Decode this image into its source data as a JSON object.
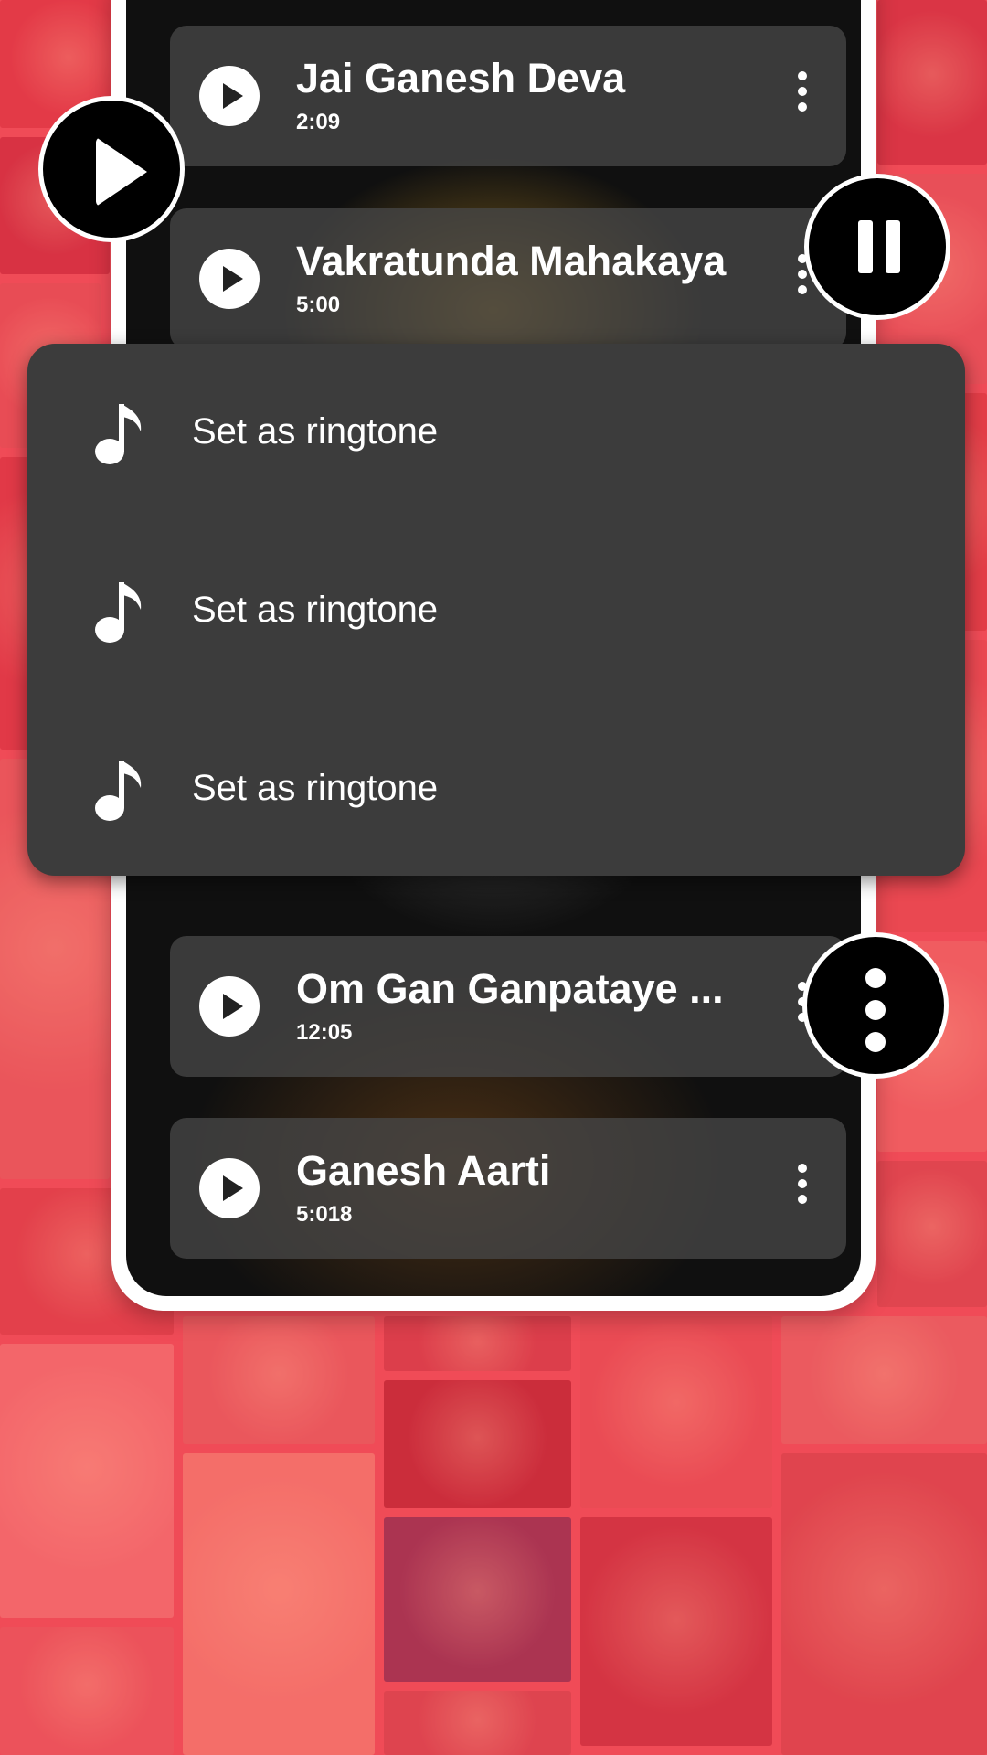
{
  "songs": [
    {
      "title": "Jai Ganesh Deva",
      "duration": "2:09"
    },
    {
      "title": "Vakratunda Mahakaya",
      "duration": "5:00"
    },
    {
      "title": "Om Gan Ganpataye ...",
      "duration": "12:05"
    },
    {
      "title": "Ganesh Aarti",
      "duration": "5:018"
    }
  ],
  "menu": {
    "items": [
      {
        "label": "Set as ringtone",
        "icon": "music-note-icon"
      },
      {
        "label": "Set as ringtone",
        "icon": "music-note-icon"
      },
      {
        "label": "Set as ringtone",
        "icon": "music-note-icon"
      }
    ]
  },
  "floating_buttons": {
    "play_icon": "play-icon",
    "pause_icon": "pause-icon",
    "more_icon": "more-vertical-icon"
  },
  "colors": {
    "background": "#ea4a55",
    "menu": "#3c3c3c",
    "card": "#464646"
  }
}
